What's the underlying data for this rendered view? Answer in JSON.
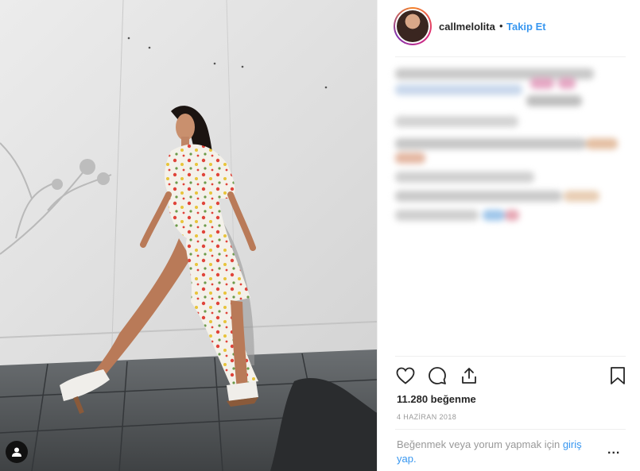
{
  "post": {
    "username": "callmelolita",
    "separator": "•",
    "follow_label": "Takip Et",
    "likes_text": "11.280 beğenme",
    "date_text": "4 HAZİRAN 2018",
    "login_prompt": "Beğenmek veya yorum yapmak için ",
    "login_link": "giriş yap.",
    "more_label": "..."
  },
  "icons": {
    "like": "heart-icon",
    "comment": "comment-icon",
    "share": "share-icon",
    "save": "bookmark-icon",
    "tag": "user-tag-icon"
  },
  "colors": {
    "link": "#3897f0",
    "text": "#262626",
    "muted": "#999999",
    "divider": "#efefef"
  }
}
